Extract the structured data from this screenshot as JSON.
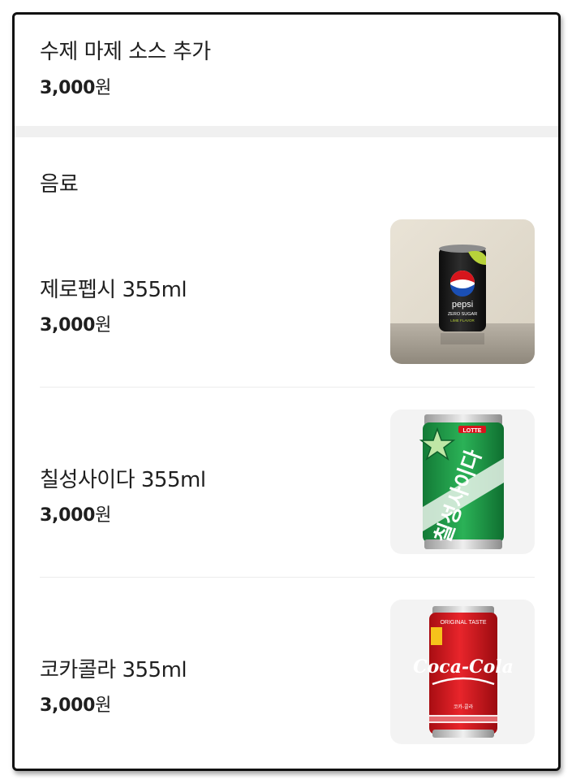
{
  "top_option": {
    "title": "수제 마제 소스 추가",
    "price_amount": "3,000",
    "price_unit": "원"
  },
  "section": {
    "title": "음료"
  },
  "items": [
    {
      "name": "제로펩시 355ml",
      "price_amount": "3,000",
      "price_unit": "원",
      "image": {
        "brand": "pepsi",
        "can_text": "pepsi",
        "can_sub": "ZERO SUGAR",
        "can_sub2": "LIME FLAVOR"
      }
    },
    {
      "name": "칠성사이다 355ml",
      "price_amount": "3,000",
      "price_unit": "원",
      "image": {
        "brand": "chilsung-cider",
        "can_top": "LOTTE",
        "can_text": "칠성사이다"
      }
    },
    {
      "name": "코카콜라 355ml",
      "price_amount": "3,000",
      "price_unit": "원",
      "image": {
        "brand": "coca-cola",
        "can_top": "ORIGINAL TASTE",
        "can_text": "Coca-Cola",
        "can_sub": "코카-콜라"
      }
    }
  ],
  "colors": {
    "text": "#1f1f1f",
    "band": "#f0f0f0",
    "separator": "#ececec",
    "pepsi_can": "#1b1b1b",
    "pepsi_lime": "#b8d23a",
    "cider_green": "#1f9a48",
    "coke_red": "#d8151c"
  }
}
